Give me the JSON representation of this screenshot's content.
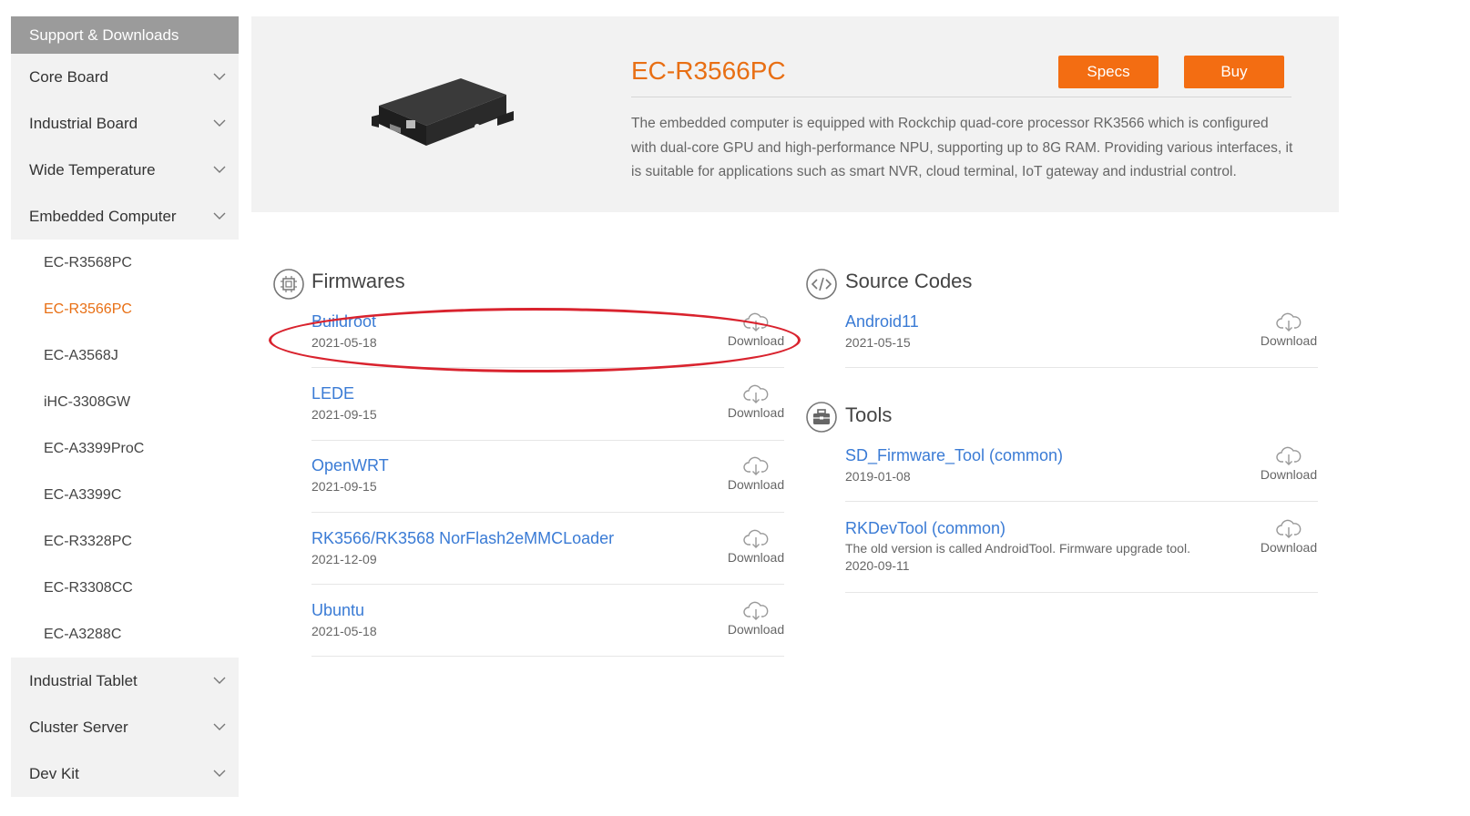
{
  "sidebar": {
    "header": "Support & Downloads",
    "categories_top": [
      {
        "label": "Core Board"
      },
      {
        "label": "Industrial Board"
      },
      {
        "label": "Wide Temperature"
      },
      {
        "label": "Embedded Computer"
      }
    ],
    "subitems": [
      {
        "label": "EC-R3568PC"
      },
      {
        "label": "EC-R3566PC"
      },
      {
        "label": "EC-A3568J"
      },
      {
        "label": "iHC-3308GW"
      },
      {
        "label": "EC-A3399ProC"
      },
      {
        "label": "EC-A3399C"
      },
      {
        "label": "EC-R3328PC"
      },
      {
        "label": "EC-R3308CC"
      },
      {
        "label": "EC-A3288C"
      }
    ],
    "active_subitem": "EC-R3566PC",
    "categories_bottom": [
      {
        "label": "Industrial Tablet"
      },
      {
        "label": "Cluster Server"
      },
      {
        "label": "Dev Kit"
      }
    ]
  },
  "product": {
    "title": "EC-R3566PC",
    "specs_label": "Specs",
    "buy_label": "Buy",
    "description": "The embedded computer is equipped with Rockchip quad-core processor RK3566 which is configured with dual-core GPU and high-performance NPU, supporting up to 8G RAM. Providing various interfaces, it is suitable for applications such as smart NVR, cloud terminal, IoT gateway and industrial control."
  },
  "firmwares": {
    "title": "Firmwares",
    "items": [
      {
        "name": "Buildroot",
        "date": "2021-05-18",
        "download_label": "Download"
      },
      {
        "name": "LEDE",
        "date": "2021-09-15",
        "download_label": "Download"
      },
      {
        "name": "OpenWRT",
        "date": "2021-09-15",
        "download_label": "Download"
      },
      {
        "name": "RK3566/RK3568 NorFlash2eMMCLoader",
        "date": "2021-12-09",
        "download_label": "Download"
      },
      {
        "name": "Ubuntu",
        "date": "2021-05-18",
        "download_label": "Download"
      }
    ]
  },
  "source_codes": {
    "title": "Source Codes",
    "items": [
      {
        "name": "Android11",
        "date": "2021-05-15",
        "download_label": "Download"
      }
    ]
  },
  "tools": {
    "title": "Tools",
    "items": [
      {
        "name": "SD_Firmware_Tool (common)",
        "date": "2019-01-08",
        "download_label": "Download"
      },
      {
        "name": "RKDevTool (common)",
        "note": "The old version is called AndroidTool. Firmware upgrade tool.",
        "date": "2020-09-11",
        "download_label": "Download"
      }
    ]
  },
  "colors": {
    "accent": "#e86f14",
    "button": "#f36d12",
    "link": "#3a7bd5",
    "annotation": "#d9232e"
  }
}
